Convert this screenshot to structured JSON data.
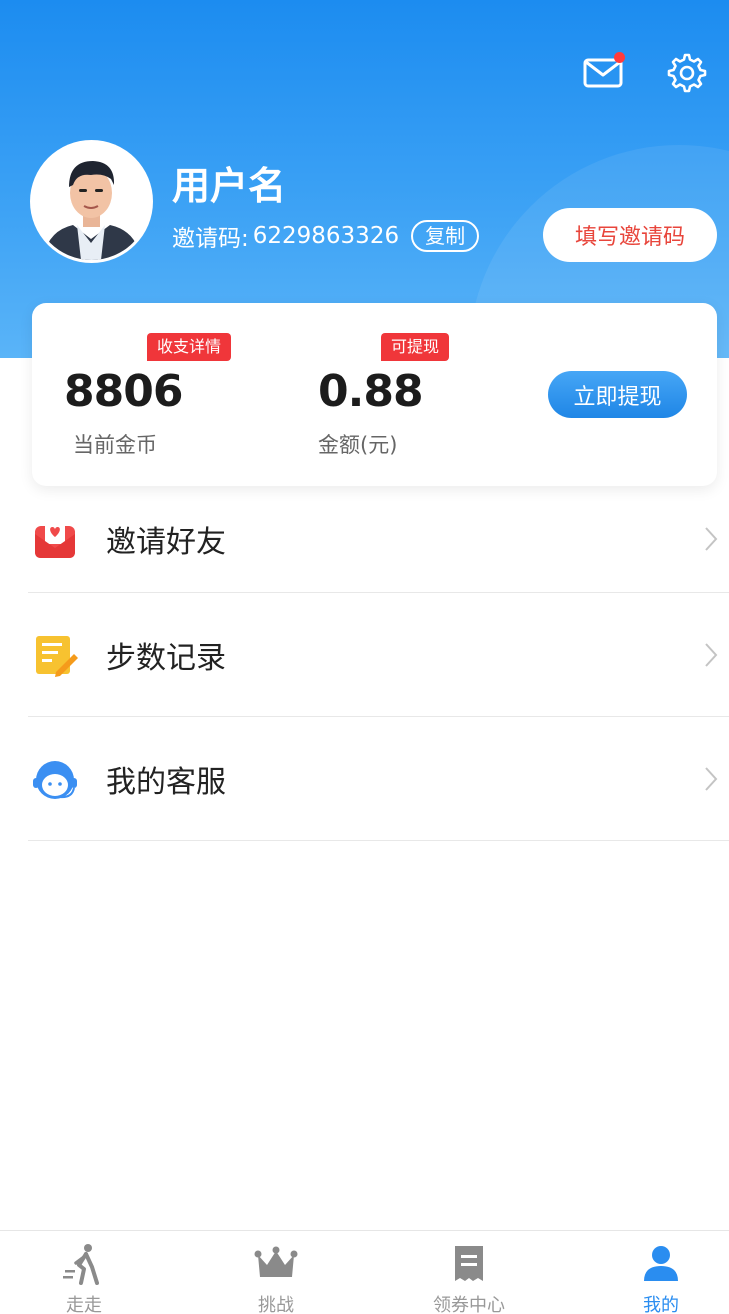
{
  "header": {
    "username": "用户名",
    "invite_label": "邀请码:",
    "invite_code": "6229863326",
    "copy_label": "复制",
    "fill_invite_label": "填写邀请码",
    "has_unread_mail": true
  },
  "wallet": {
    "detail_tag": "收支详情",
    "withdrawable_tag": "可提现",
    "coins_value": "8806",
    "coins_label": "当前金币",
    "amount_value": "0.88",
    "amount_label": "金额(元)",
    "withdraw_label": "立即提现"
  },
  "menu": {
    "items": [
      {
        "label": "邀请好友",
        "icon": "invite-envelope-icon"
      },
      {
        "label": "步数记录",
        "icon": "notepad-icon"
      },
      {
        "label": "我的客服",
        "icon": "customer-service-icon"
      }
    ]
  },
  "tabbar": {
    "tabs": [
      {
        "label": "走走",
        "icon": "walking-person-icon",
        "active": false
      },
      {
        "label": "挑战",
        "icon": "crown-icon",
        "active": false
      },
      {
        "label": "领券中心",
        "icon": "receipt-icon",
        "active": false
      },
      {
        "label": "我的",
        "icon": "user-icon",
        "active": true
      }
    ]
  },
  "colors": {
    "primary_blue": "#1c8cf0",
    "accent_red": "#f0363a",
    "active_tab": "#2a8df0",
    "inactive_tab": "#999999"
  }
}
